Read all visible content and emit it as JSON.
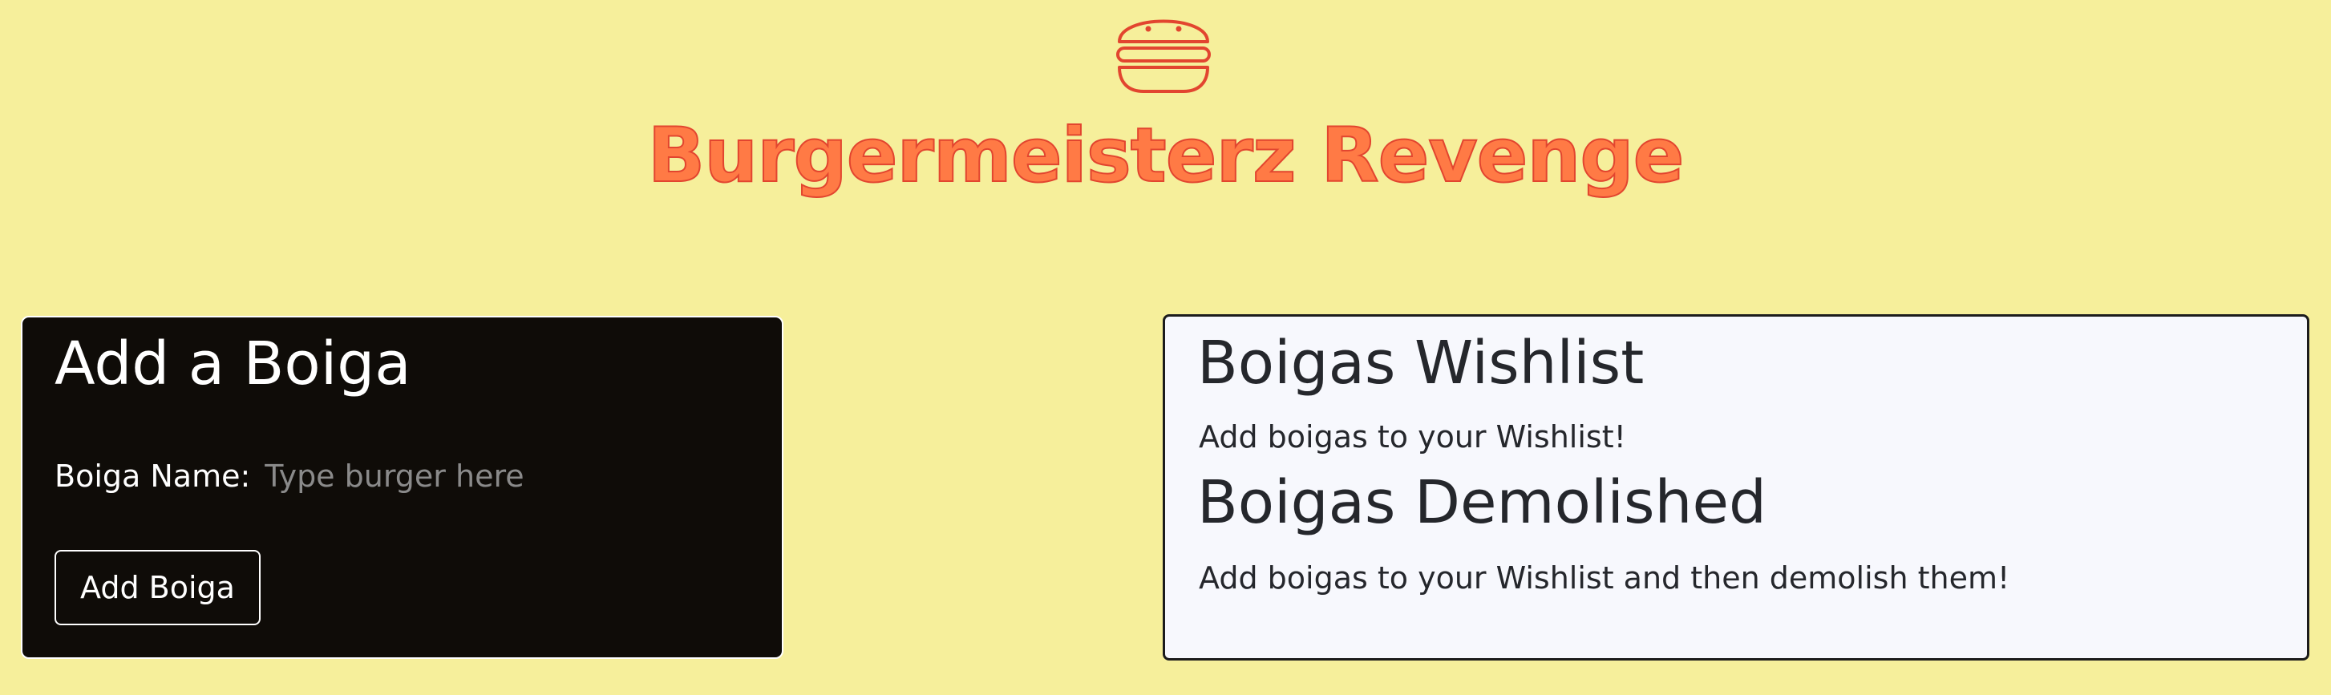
{
  "app": {
    "title": "Burgermeisterz Revenge",
    "logo_icon": "burger-icon",
    "colors": {
      "background": "#f6ef9b",
      "title_fill": "#ff7a45",
      "title_stroke": "#e2452f"
    }
  },
  "add_form": {
    "heading": "Add a Boiga",
    "name_label": "Boiga Name:",
    "name_placeholder": "Type burger here",
    "name_value": "",
    "submit_label": "Add Boiga"
  },
  "wishlist": {
    "heading": "Boigas Wishlist",
    "empty_text": "Add boigas to your Wishlist!"
  },
  "demolished": {
    "heading": "Boigas Demolished",
    "empty_text": "Add boigas to your Wishlist and then demolish them!"
  }
}
